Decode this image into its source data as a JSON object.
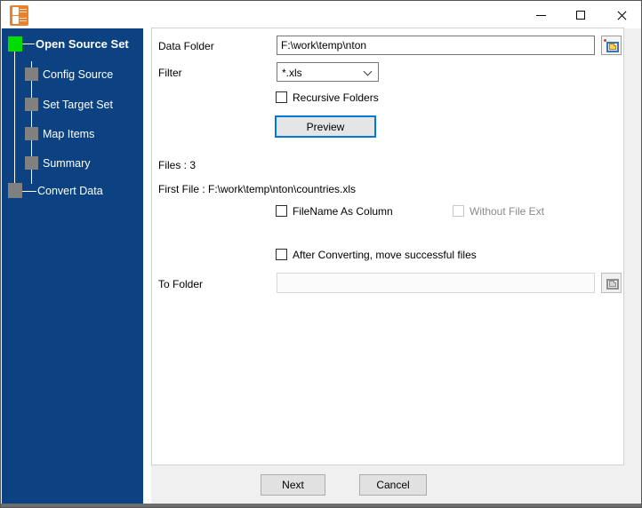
{
  "titlebar": {
    "title": ""
  },
  "colors": {
    "sidebar_background": "#0c4281",
    "active_step_square": "#00dc00",
    "inactive_step_square": "#808080",
    "focus_border": "#0078d7",
    "app_icon_orange": "#e8822c"
  },
  "sidebar": {
    "steps": [
      {
        "label": "Open Source Set",
        "active": true
      },
      {
        "label": "Config Source",
        "active": false
      },
      {
        "label": "Set Target Set",
        "active": false
      },
      {
        "label": "Map Items",
        "active": false
      },
      {
        "label": "Summary",
        "active": false
      },
      {
        "label": "Convert Data",
        "active": false
      }
    ]
  },
  "form": {
    "data_folder": {
      "label": "Data Folder",
      "value": "F:\\work\\temp\\nton"
    },
    "filter": {
      "label": "Filter",
      "value": "*.xls"
    },
    "recursive": {
      "label": "Recursive Folders",
      "checked": false
    },
    "preview_button": "Preview",
    "files_count": "Files : 3",
    "first_file": "First File : F:\\work\\temp\\nton\\countries.xls",
    "filename_as_column": {
      "label": "FileName As Column",
      "checked": false
    },
    "without_file_ext": {
      "label": "Without File Ext",
      "checked": false,
      "disabled": true
    },
    "move_files": {
      "label": "After Converting, move successful files",
      "checked": false
    },
    "to_folder": {
      "label": "To Folder",
      "value": "",
      "disabled": true
    }
  },
  "footer": {
    "next_button": "Next",
    "cancel_button": "Cancel"
  }
}
